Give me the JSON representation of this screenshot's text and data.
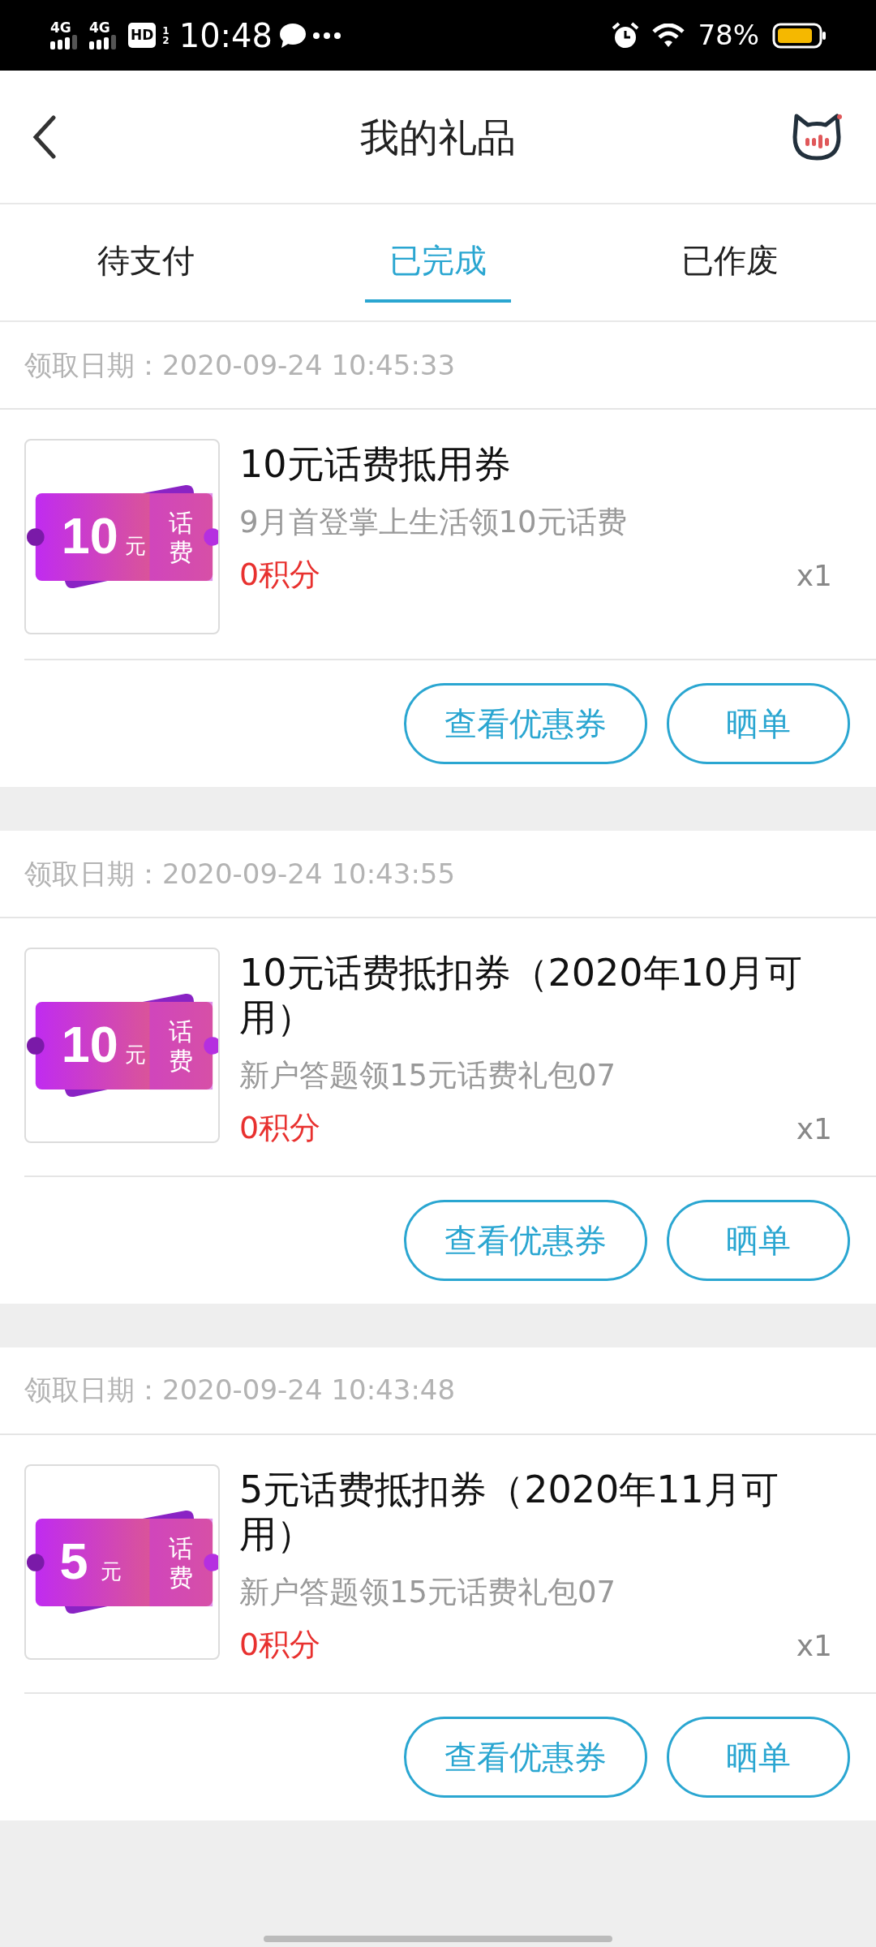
{
  "status_bar": {
    "network_labels": [
      "4G",
      "4G"
    ],
    "hd": "HD",
    "hd_sims": [
      "1",
      "2"
    ],
    "time": "10:48",
    "battery": "78%"
  },
  "header": {
    "title": "我的礼品"
  },
  "tabs": [
    {
      "label": "待支付",
      "selected": false
    },
    {
      "label": "已完成",
      "selected": true
    },
    {
      "label": "已作废",
      "selected": false
    }
  ],
  "orders": [
    {
      "date_label": "领取日期：",
      "date": "2020-09-24 10:45:33",
      "coupon_image": {
        "amount": "10",
        "unit": "元",
        "label": "话费"
      },
      "title": "10元话费抵用券",
      "subtitle": "9月首登掌上生活领10元话费",
      "points": "0积分",
      "quantity": "x1",
      "buttons": [
        "查看优惠券",
        "晒单"
      ]
    },
    {
      "date_label": "领取日期：",
      "date": "2020-09-24 10:43:55",
      "coupon_image": {
        "amount": "10",
        "unit": "元",
        "label": "话费"
      },
      "title": "10元话费抵扣券（2020年10月可用）",
      "subtitle": "新户答题领15元话费礼包07",
      "points": "0积分",
      "quantity": "x1",
      "buttons": [
        "查看优惠券",
        "晒单"
      ]
    },
    {
      "date_label": "领取日期：",
      "date": "2020-09-24 10:43:48",
      "coupon_image": {
        "amount": "5",
        "unit": "元",
        "label": "话费"
      },
      "title": "5元话费抵扣券（2020年11月可用）",
      "subtitle": "新户答题领15元话费礼包07",
      "points": "0积分",
      "quantity": "x1",
      "buttons": [
        "查看优惠券",
        "晒单"
      ]
    }
  ]
}
